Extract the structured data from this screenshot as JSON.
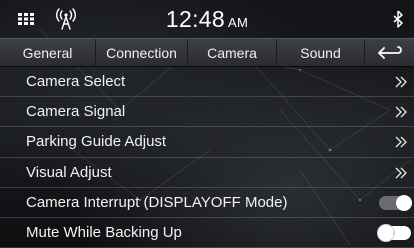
{
  "status_bar": {
    "time": "12:48",
    "ampm": "AM",
    "menu_icon": "grid-menu-icon",
    "radio_icon": "antenna-icon",
    "bluetooth_icon": "bluetooth-icon"
  },
  "tabs": [
    {
      "label": "General",
      "selected": false
    },
    {
      "label": "Connection",
      "selected": false
    },
    {
      "label": "Camera",
      "selected": true
    },
    {
      "label": "Sound",
      "selected": false
    }
  ],
  "back_icon": "return-arrow-icon",
  "rows": [
    {
      "label": "Camera Select",
      "control": "chevron"
    },
    {
      "label": "Camera Signal",
      "control": "chevron"
    },
    {
      "label": "Parking Guide Adjust",
      "control": "chevron"
    },
    {
      "label": "Visual Adjust",
      "control": "chevron"
    },
    {
      "label": "Camera Interrupt (DISPLAYOFF Mode)",
      "control": "toggle",
      "state": "on"
    },
    {
      "label": "Mute While Backing Up",
      "control": "toggle",
      "state": "off"
    }
  ],
  "colors": {
    "toggle_on_track": "#6a6c70",
    "toggle_off_track": "#ffffff",
    "tab_bar": "#34363b"
  }
}
